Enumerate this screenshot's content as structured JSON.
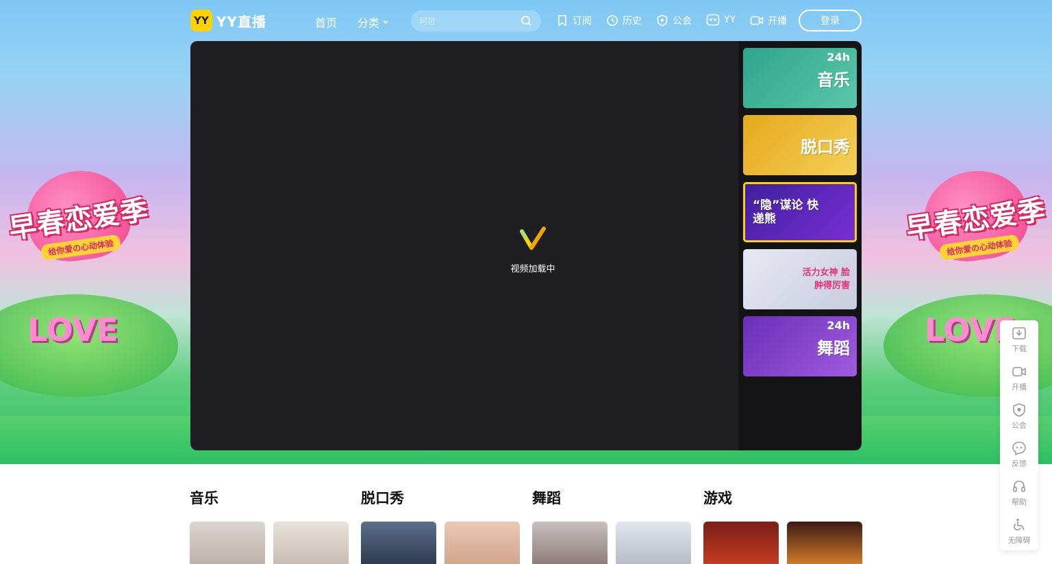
{
  "brand": {
    "badge": "YY",
    "name": "YY直播"
  },
  "nav": {
    "home": "首页",
    "category": "分类"
  },
  "search": {
    "placeholder": "阿哲"
  },
  "header_items": [
    {
      "label": "订阅",
      "icon": "bookmark-icon"
    },
    {
      "label": "历史",
      "icon": "clock-icon"
    },
    {
      "label": "公会",
      "icon": "shield-star-icon"
    },
    {
      "label": "YY",
      "icon": "yy-app-icon"
    },
    {
      "label": "开播",
      "icon": "video-camera-icon"
    }
  ],
  "login": "登录",
  "banner": {
    "title": "早春恋爱季",
    "subtitle": "给你爱の心动体验",
    "love": "LOVE"
  },
  "player": {
    "loading": "视频加载中"
  },
  "channels": [
    {
      "label": "音乐",
      "badge": "24h",
      "color": "#34b39a"
    },
    {
      "label": "脱口秀",
      "badge": "",
      "color": "#e9b424"
    },
    {
      "label": "“隐”谋论 快递熊",
      "badge": "",
      "color": "#4a2aa8"
    },
    {
      "label": "活力女神 脸肿得厉害",
      "badge": "",
      "color": "#d6d9e8"
    },
    {
      "label": "舞蹈",
      "badge": "24h",
      "color": "#7b3dc4"
    }
  ],
  "sections": [
    "音乐",
    "脱口秀",
    "舞蹈",
    "游戏"
  ],
  "side_bar": [
    {
      "label": "下载",
      "icon": "download-icon"
    },
    {
      "label": "开播",
      "icon": "video-camera-icon"
    },
    {
      "label": "公会",
      "icon": "shield-star-icon"
    },
    {
      "label": "反馈",
      "icon": "feedback-icon"
    },
    {
      "label": "帮助",
      "icon": "headset-icon"
    },
    {
      "label": "无障碍",
      "icon": "accessibility-icon"
    }
  ]
}
